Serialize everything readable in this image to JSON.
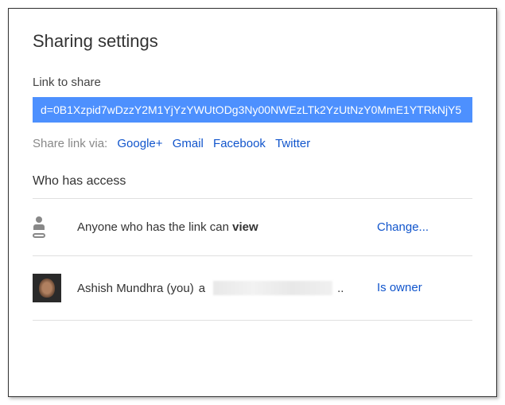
{
  "title": "Sharing settings",
  "link": {
    "label": "Link to share",
    "value": "d=0B1Xzpid7wDzzY2M1YjYzYWUtODg3Ny00NWEzLTk2YzUtNzY0MmE1YTRkNjY5"
  },
  "shareVia": {
    "label": "Share link via:",
    "options": [
      "Google+",
      "Gmail",
      "Facebook",
      "Twitter"
    ]
  },
  "access": {
    "label": "Who has access",
    "rows": [
      {
        "textPrefix": "Anyone who has the link can ",
        "textBold": "view",
        "action": "Change..."
      },
      {
        "name": "Ashish Mundhra (you)",
        "emailPrefix": "a",
        "emailSuffix": "..",
        "role": "Is owner"
      }
    ]
  }
}
